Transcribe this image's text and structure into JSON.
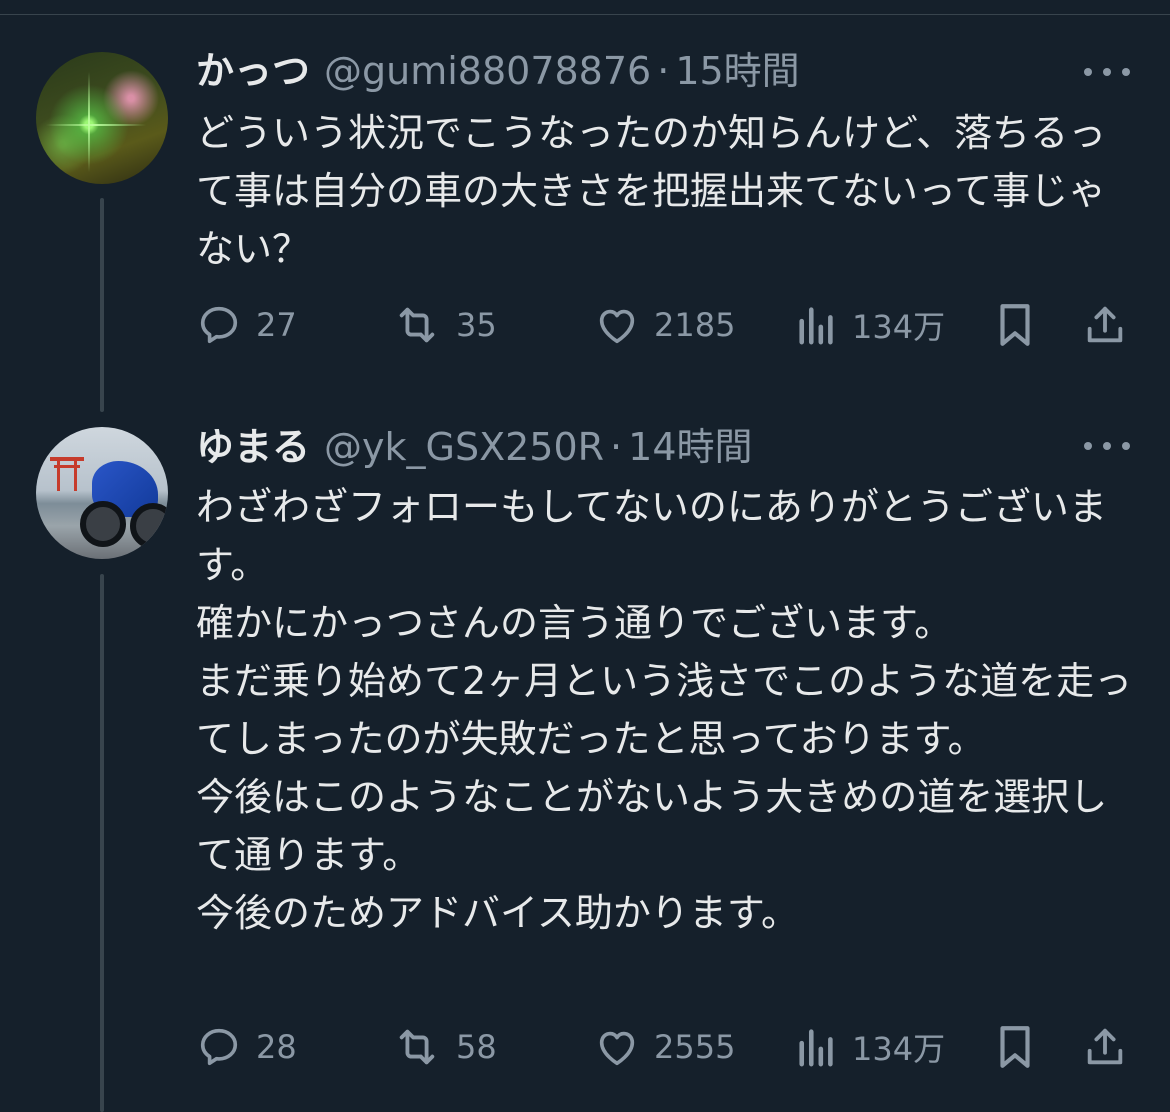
{
  "tweets": [
    {
      "name": "かっつ",
      "handle": "@gumi88078876",
      "separator": "·",
      "time": "15時間",
      "text": "どういう状況でこうなったのか知らんけど、落ちるって事は自分の車の大きさを把握出来てないって事じゃない？",
      "actions": {
        "replies": "27",
        "retweets": "35",
        "likes": "2185",
        "views": "134万"
      }
    },
    {
      "name": "ゆまる",
      "handle": "@yk_GSX250R",
      "separator": "·",
      "time": "14時間",
      "text": "わざわざフォローもしてないのにありがとうございます。\n確かにかっつさんの言う通りでございます。\nまだ乗り始めて2ヶ月という浅さでこのような道を走ってしまったのが失敗だったと思っております。\n今後はこのようなことがないよう大きめの道を選択して通ります。\n今後のためアドバイス助かります。",
      "actions": {
        "replies": "28",
        "retweets": "58",
        "likes": "2555",
        "views": "134万"
      }
    }
  ],
  "icons": {
    "reply": "reply-icon",
    "retweet": "retweet-icon",
    "like": "heart-icon",
    "views": "views-icon",
    "bookmark": "bookmark-icon",
    "share": "share-icon",
    "more": "more-icon"
  },
  "colors": {
    "background": "#15202b",
    "text": "#e7e9ea",
    "secondary": "#8b98a5",
    "divider": "#38444d"
  }
}
